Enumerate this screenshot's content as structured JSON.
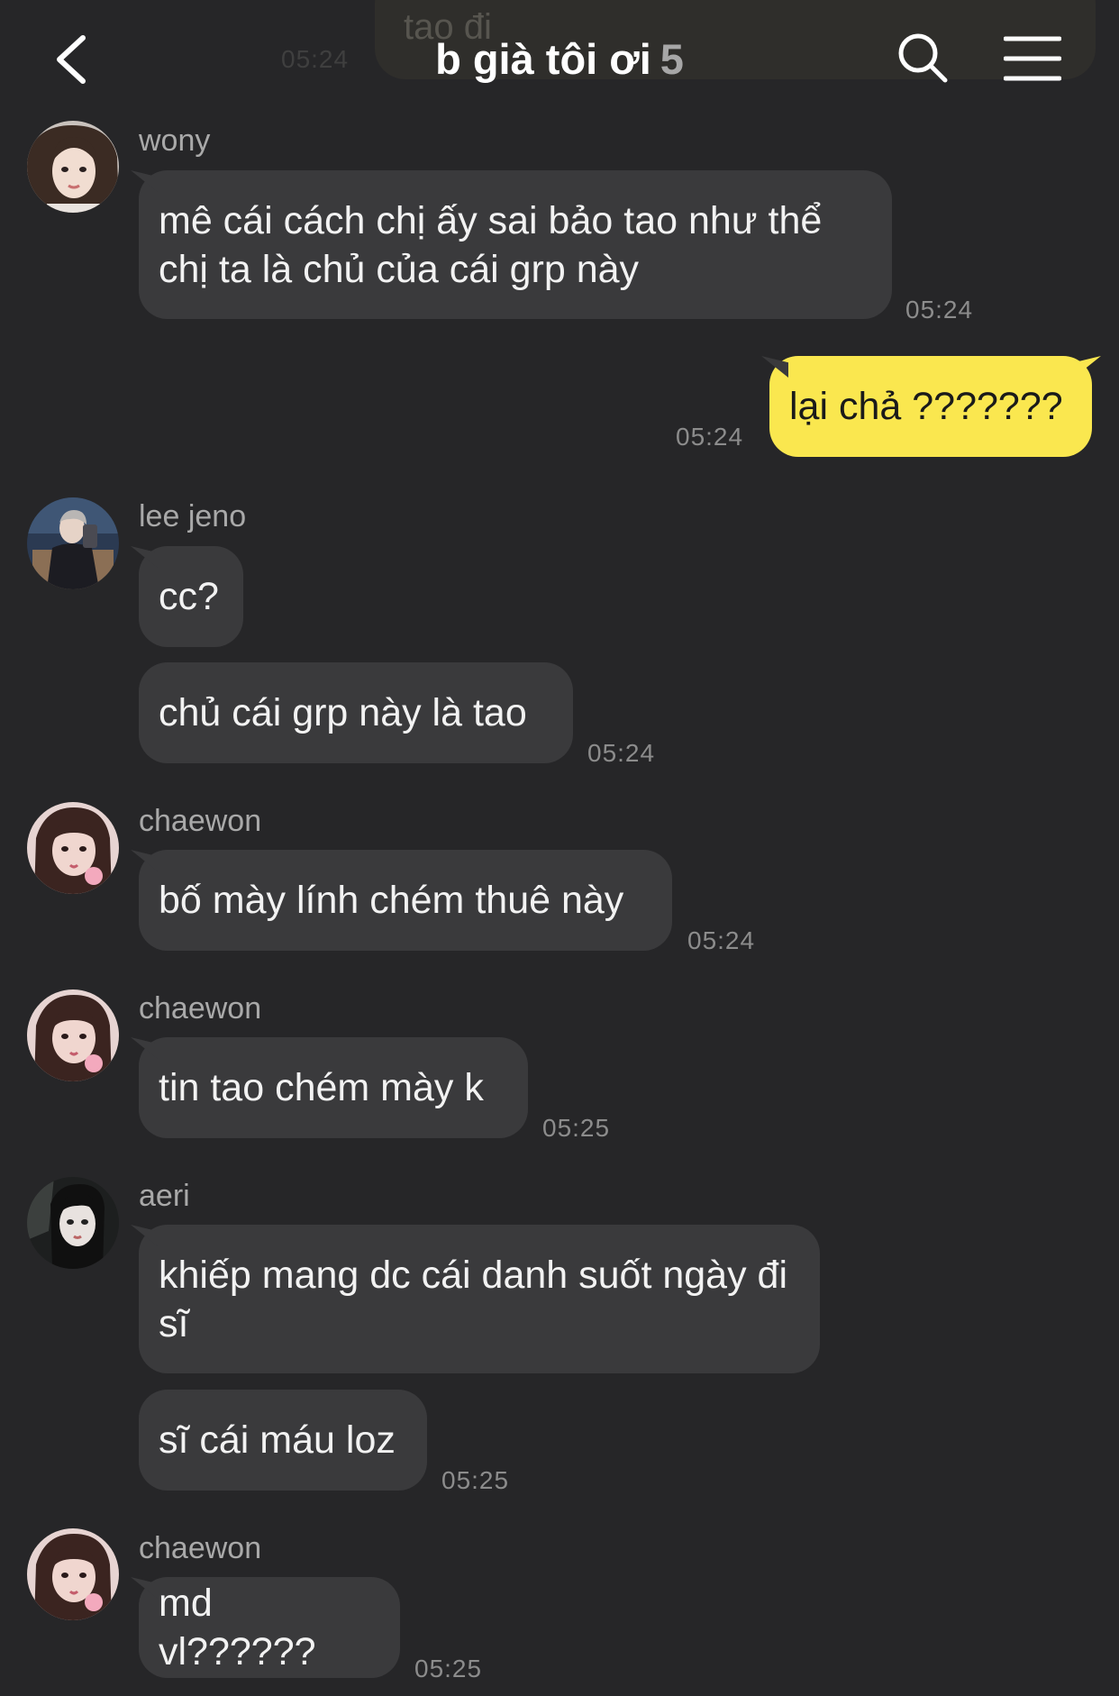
{
  "header": {
    "title": "b già tôi ơi",
    "member_count": "5",
    "peek_message_text": "tao đi",
    "peek_message_time": "05:24"
  },
  "colors": {
    "background": "#262628",
    "incoming_bubble": "#3a3a3c",
    "outgoing_bubble": "#fae74f"
  },
  "messages": [
    {
      "sender": "wony",
      "text": "mê cái cách chị ấy sai bảo tao như thể chị ta là chủ của cái grp này",
      "time": "05:24"
    },
    {
      "sender": "me",
      "text": "lại chả ???????",
      "time": "05:24"
    },
    {
      "sender": "lee jeno",
      "text": "cc?"
    },
    {
      "sender": "lee jeno",
      "text": "chủ cái grp này là tao",
      "time": "05:24"
    },
    {
      "sender": "chaewon",
      "text": "bố mày lính chém thuê này",
      "time": "05:24"
    },
    {
      "sender": "chaewon",
      "text": "tin tao chém mày k",
      "time": "05:25"
    },
    {
      "sender": "aeri",
      "text": "khiếp mang dc cái danh suốt ngày đi sĩ"
    },
    {
      "sender": "aeri",
      "text": "sĩ cái máu loz",
      "time": "05:25"
    },
    {
      "sender": "chaewon",
      "text": "md vl??????",
      "time": "05:25"
    }
  ],
  "icons": {
    "back": "chevron-left-icon",
    "search": "search-icon",
    "menu": "hamburger-menu-icon"
  }
}
